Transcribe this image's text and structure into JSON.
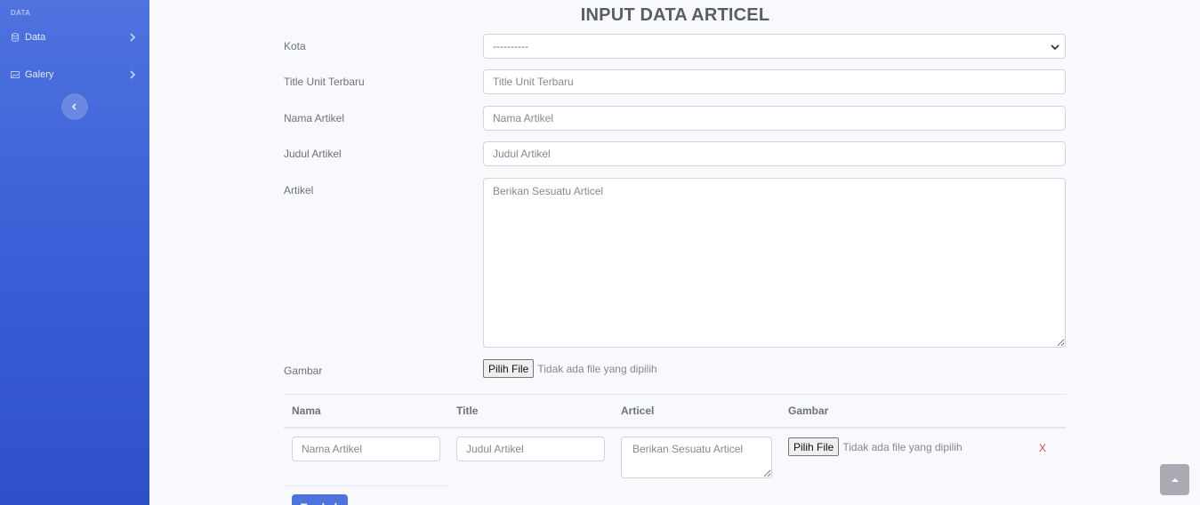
{
  "sidebar": {
    "heading": "DATA",
    "items": [
      {
        "label": "Data",
        "icon": "database-icon"
      },
      {
        "label": "Galery",
        "icon": "image-icon"
      }
    ]
  },
  "page_title": "INPUT DATA ARTICEL",
  "form": {
    "kota": {
      "label": "Kota",
      "value": "----------"
    },
    "title_unit": {
      "label": "Title Unit Terbaru",
      "placeholder": "Title Unit Terbaru"
    },
    "nama_artikel": {
      "label": "Nama Artikel",
      "placeholder": "Nama Artikel"
    },
    "judul_artikel": {
      "label": "Judul Artikel",
      "placeholder": "Judul Artikel"
    },
    "artikel": {
      "label": "Artikel",
      "placeholder": "Berikan Sesuatu Articel"
    },
    "gambar": {
      "label": "Gambar",
      "button": "Pilih File",
      "status": "Tidak ada file yang dipilih"
    }
  },
  "table": {
    "headers": [
      "Nama",
      "Title",
      "Articel",
      "Gambar"
    ],
    "row": {
      "nama_placeholder": "Nama Artikel",
      "title_placeholder": "Judul Artikel",
      "articel_placeholder": "Berikan Sesuatu Articel",
      "file_button": "Pilih File",
      "file_status": "Tidak ada file yang dipilih",
      "remove": "X"
    },
    "add_button": "Tambah"
  },
  "colors": {
    "sidebar": "#4e73df",
    "danger": "#e74a3b",
    "primary": "#4e73df"
  }
}
